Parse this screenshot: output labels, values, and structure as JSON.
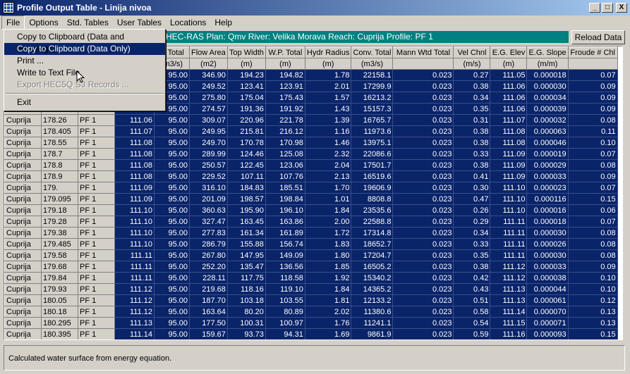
{
  "window": {
    "title": "Profile Output Table - Linija nivoa",
    "minimize": "_",
    "maximize": "□",
    "close": "X"
  },
  "menu": [
    "File",
    "Options",
    "Std. Tables",
    "User Tables",
    "Locations",
    "Help"
  ],
  "file_menu": {
    "items": [
      {
        "label": "Copy to Clipboard (Data and Headings)",
        "state": "normal"
      },
      {
        "label": "Copy to Clipboard (Data Only)",
        "state": "active"
      },
      {
        "label": "Print ...",
        "state": "normal"
      },
      {
        "label": "Write to Text File",
        "state": "normal"
      },
      {
        "label": "Export HEC5Q S3 Records ...",
        "state": "disabled"
      }
    ],
    "exit": "Exit"
  },
  "info_bar": "HEC-RAS  Plan: Qmv   River: Velika Morava   Reach: Cuprija    Profile: PF 1",
  "reload_button": "Reload Data",
  "table": {
    "headers": [
      "",
      "",
      "",
      "",
      "Q Total",
      "Flow Area",
      "Top Width",
      "W.P. Total",
      "Hydr Radius",
      "Conv. Total",
      "Mann Wtd Total",
      "Vel Chnl",
      "E.G. Elev",
      "E.G. Slope",
      "Froude # Chl"
    ],
    "units": [
      "",
      "",
      "",
      "",
      "(m3/s)",
      "(m2)",
      "(m)",
      "(m)",
      "(m)",
      "(m3/s)",
      "",
      "(m/s)",
      "(m)",
      "(m/m)",
      ""
    ],
    "rows": [
      [
        "",
        "",
        "",
        "",
        "95.00",
        "346.90",
        "194.23",
        "194.82",
        "1.78",
        "22158.1",
        "0.023",
        "0.27",
        "111.05",
        "0.000018",
        "0.07"
      ],
      [
        "",
        "",
        "",
        "",
        "95.00",
        "249.52",
        "123.41",
        "123.91",
        "2.01",
        "17299.9",
        "0.023",
        "0.38",
        "111.06",
        "0.000030",
        "0.09"
      ],
      [
        "",
        "",
        "",
        "",
        "95.00",
        "275.80",
        "175.04",
        "175.43",
        "1.57",
        "16213.2",
        "0.023",
        "0.34",
        "111.06",
        "0.000034",
        "0.09"
      ],
      [
        "",
        "",
        "",
        "",
        "95.00",
        "274.57",
        "191.36",
        "191.92",
        "1.43",
        "15157.3",
        "0.023",
        "0.35",
        "111.06",
        "0.000039",
        "0.09"
      ],
      [
        "Cuprija",
        "178.26",
        "PF 1",
        "111.06",
        "95.00",
        "309.07",
        "220.96",
        "221.78",
        "1.39",
        "16765.7",
        "0.023",
        "0.31",
        "111.07",
        "0.000032",
        "0.08"
      ],
      [
        "Cuprija",
        "178.405",
        "PF 1",
        "111.07",
        "95.00",
        "249.95",
        "215.81",
        "216.12",
        "1.16",
        "11973.6",
        "0.023",
        "0.38",
        "111.08",
        "0.000063",
        "0.11"
      ],
      [
        "Cuprija",
        "178.55",
        "PF 1",
        "111.08",
        "95.00",
        "249.70",
        "170.78",
        "170.98",
        "1.46",
        "13975.1",
        "0.023",
        "0.38",
        "111.08",
        "0.000046",
        "0.10"
      ],
      [
        "Cuprija",
        "178.7",
        "PF 1",
        "111.08",
        "95.00",
        "289.99",
        "124.46",
        "125.08",
        "2.32",
        "22086.6",
        "0.023",
        "0.33",
        "111.09",
        "0.000019",
        "0.07"
      ],
      [
        "Cuprija",
        "178.8",
        "PF 1",
        "111.08",
        "95.00",
        "250.57",
        "122.45",
        "123.06",
        "2.04",
        "17501.7",
        "0.023",
        "0.38",
        "111.09",
        "0.000029",
        "0.08"
      ],
      [
        "Cuprija",
        "178.9",
        "PF 1",
        "111.08",
        "95.00",
        "229.52",
        "107.11",
        "107.76",
        "2.13",
        "16519.6",
        "0.023",
        "0.41",
        "111.09",
        "0.000033",
        "0.09"
      ],
      [
        "Cuprija",
        "179.",
        "PF 1",
        "111.09",
        "95.00",
        "316.10",
        "184.83",
        "185.51",
        "1.70",
        "19606.9",
        "0.023",
        "0.30",
        "111.10",
        "0.000023",
        "0.07"
      ],
      [
        "Cuprija",
        "179.095",
        "PF 1",
        "111.09",
        "95.00",
        "201.09",
        "198.57",
        "198.84",
        "1.01",
        "8808.8",
        "0.023",
        "0.47",
        "111.10",
        "0.000116",
        "0.15"
      ],
      [
        "Cuprija",
        "179.18",
        "PF 1",
        "111.10",
        "95.00",
        "360.63",
        "195.90",
        "196.10",
        "1.84",
        "23535.6",
        "0.023",
        "0.26",
        "111.10",
        "0.000016",
        "0.06"
      ],
      [
        "Cuprija",
        "179.28",
        "PF 1",
        "111.10",
        "95.00",
        "327.47",
        "163.45",
        "163.86",
        "2.00",
        "22588.8",
        "0.023",
        "0.29",
        "111.11",
        "0.000018",
        "0.07"
      ],
      [
        "Cuprija",
        "179.38",
        "PF 1",
        "111.10",
        "95.00",
        "277.83",
        "161.34",
        "161.89",
        "1.72",
        "17314.8",
        "0.023",
        "0.34",
        "111.11",
        "0.000030",
        "0.08"
      ],
      [
        "Cuprija",
        "179.485",
        "PF 1",
        "111.10",
        "95.00",
        "286.79",
        "155.88",
        "156.74",
        "1.83",
        "18652.7",
        "0.023",
        "0.33",
        "111.11",
        "0.000026",
        "0.08"
      ],
      [
        "Cuprija",
        "179.58",
        "PF 1",
        "111.11",
        "95.00",
        "267.80",
        "147.95",
        "149.09",
        "1.80",
        "17204.7",
        "0.023",
        "0.35",
        "111.11",
        "0.000030",
        "0.08"
      ],
      [
        "Cuprija",
        "179.68",
        "PF 1",
        "111.11",
        "95.00",
        "252.20",
        "135.47",
        "136.56",
        "1.85",
        "16505.2",
        "0.023",
        "0.38",
        "111.12",
        "0.000033",
        "0.09"
      ],
      [
        "Cuprija",
        "179.84",
        "PF 1",
        "111.11",
        "95.00",
        "228.11",
        "117.75",
        "118.58",
        "1.92",
        "15340.2",
        "0.023",
        "0.42",
        "111.12",
        "0.000038",
        "0.10"
      ],
      [
        "Cuprija",
        "179.93",
        "PF 1",
        "111.12",
        "95.00",
        "219.68",
        "118.16",
        "119.10",
        "1.84",
        "14365.2",
        "0.023",
        "0.43",
        "111.13",
        "0.000044",
        "0.10"
      ],
      [
        "Cuprija",
        "180.05",
        "PF 1",
        "111.12",
        "95.00",
        "187.70",
        "103.18",
        "103.55",
        "1.81",
        "12133.2",
        "0.023",
        "0.51",
        "111.13",
        "0.000061",
        "0.12"
      ],
      [
        "Cuprija",
        "180.18",
        "PF 1",
        "111.12",
        "95.00",
        "163.64",
        "80.20",
        "80.89",
        "2.02",
        "11380.6",
        "0.023",
        "0.58",
        "111.14",
        "0.000070",
        "0.13"
      ],
      [
        "Cuprija",
        "180.295",
        "PF 1",
        "111.13",
        "95.00",
        "177.50",
        "100.31",
        "100.97",
        "1.76",
        "11241.1",
        "0.023",
        "0.54",
        "111.15",
        "0.000071",
        "0.13"
      ],
      [
        "Cuprija",
        "180.395",
        "PF 1",
        "111.14",
        "95.00",
        "159.67",
        "93.73",
        "94.31",
        "1.69",
        "9861.9",
        "0.023",
        "0.59",
        "111.16",
        "0.000093",
        "0.15"
      ]
    ]
  },
  "status": "Calculated water surface from energy equation.",
  "icons": {
    "app": "table-grid-icon",
    "cursor": "arrow-cursor-icon"
  },
  "colors": {
    "title_start": "#0a246a",
    "title_end": "#a6caf0",
    "selection": "#0a246a",
    "info_bar": "#008080",
    "face": "#d4d0c8"
  }
}
